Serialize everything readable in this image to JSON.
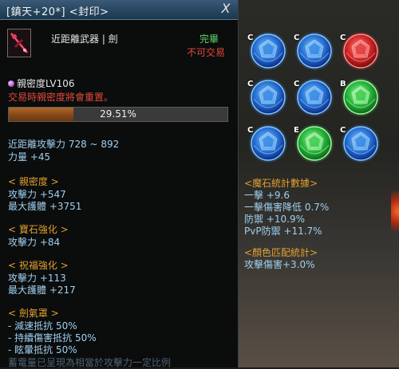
{
  "window": {
    "title": "[鎮天+20*] <封印>",
    "close_label": "X"
  },
  "item": {
    "icon": "sword-weapon-icon",
    "type": "近距離武器 | 劍",
    "status_owned": "完畢",
    "status_trade": "不可交易"
  },
  "intimacy": {
    "icon": "intimacy-orb-icon",
    "label": "親密度LV106",
    "warning": "交易時親密度將會重置。",
    "progress_text": "29.51%",
    "progress_value": 29.51
  },
  "base_stats": [
    "近距離攻擊力 728 ~ 892",
    "力量 +45"
  ],
  "sections": [
    {
      "header": "< 親密度 >",
      "lines": [
        "攻擊力 +547",
        "最大護體 +3751"
      ]
    },
    {
      "header": "< 寶石強化 >",
      "lines": [
        "攻擊力 +84"
      ]
    },
    {
      "header": "< 祝福強化 >",
      "lines": [
        "攻擊力 +113",
        "最大護體 +217"
      ]
    },
    {
      "header": "< 劍氣罩 >",
      "lines": [
        "- 減速抵抗 50%",
        "- 持續傷害抵抗 50%",
        "- 眩暈抵抗 50%"
      ]
    }
  ],
  "bottom_partial": "蓄電量已呈現為相當於攻擊力一定比例",
  "gems": [
    {
      "grade": "C",
      "color": "blue"
    },
    {
      "grade": "C",
      "color": "blue"
    },
    {
      "grade": "C",
      "color": "red"
    },
    {
      "grade": "C",
      "color": "blue"
    },
    {
      "grade": "C",
      "color": "blue"
    },
    {
      "grade": "B",
      "color": "green"
    },
    {
      "grade": "C",
      "color": "blue"
    },
    {
      "grade": "E",
      "color": "green"
    },
    {
      "grade": "C",
      "color": "blue"
    }
  ],
  "gem_colors": {
    "blue": {
      "core": "#8fd0ff",
      "mid": "#2a7ae0",
      "dark": "#0a2a8a"
    },
    "red": {
      "core": "#ff9a9a",
      "mid": "#e02a2a",
      "dark": "#7a0a0a"
    },
    "green": {
      "core": "#b6ffb0",
      "mid": "#2ac040",
      "dark": "#0a6a1a"
    }
  },
  "magic_stone": {
    "header": "<魔石統計數據>",
    "lines": [
      "一擊 +9.6",
      "一擊傷害降低 0.7%",
      "防禦 +10.9%",
      "PvP防禦 +11.7%"
    ]
  },
  "color_match": {
    "header": "<顏色匹配統計>",
    "lines": [
      "攻擊傷害+3.0%"
    ]
  }
}
